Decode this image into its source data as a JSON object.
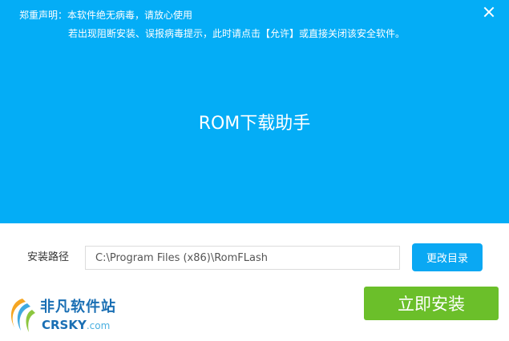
{
  "header": {
    "notice_line1": "郑重声明：本软件绝无病毒，请放心使用",
    "notice_line2": "若出现阻断安装、误报病毒提示，此时请点击【允许】或直接关闭该安全软件。",
    "close_icon": "close-icon",
    "app_title": "ROM下载助手",
    "background_color": "#04ADF6"
  },
  "install": {
    "path_label": "安装路径",
    "path_value": "C:\\Program Files (x86)\\RomFLash",
    "browse_label": "更改目录",
    "install_label": "立即安装",
    "install_color": "#6BBF2A",
    "browse_color": "#0AA8F3"
  },
  "watermark": {
    "cn_text": "非凡软件站",
    "en_text": "CRSKY",
    "domain_text": ".com",
    "logo_icon": "crsky-logo-icon"
  }
}
